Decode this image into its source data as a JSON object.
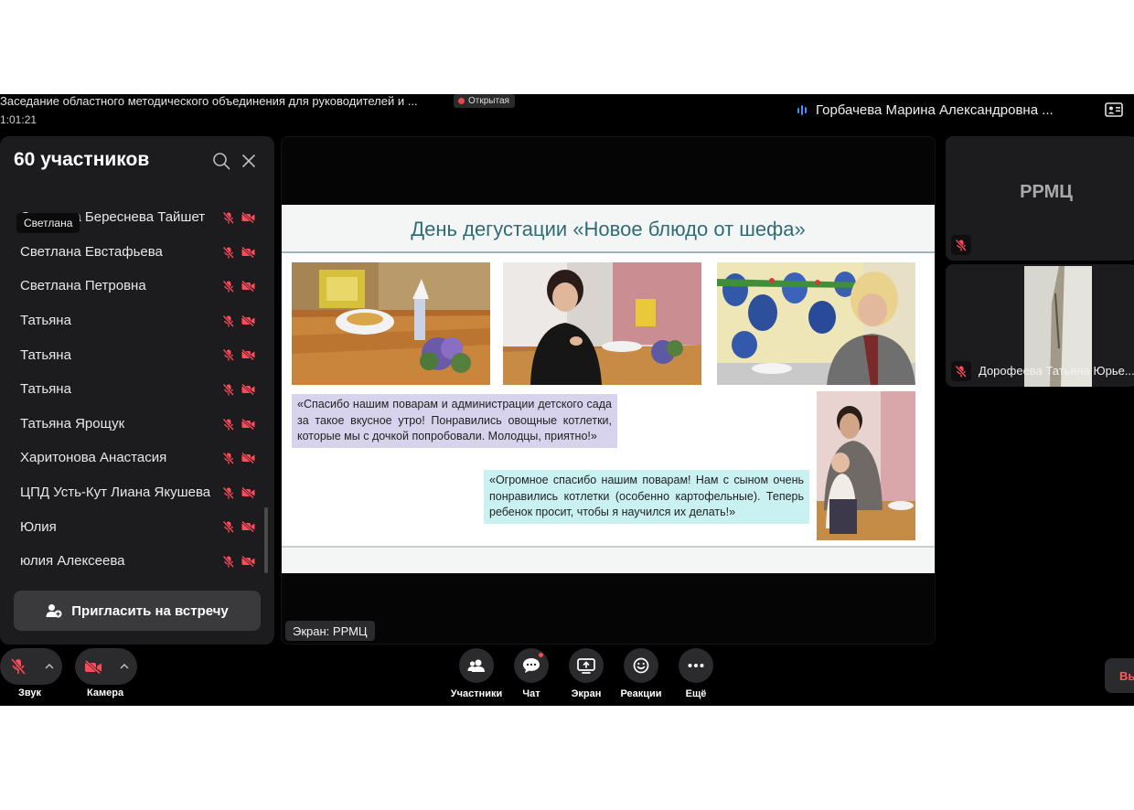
{
  "header": {
    "meeting_title": "Заседание областного методического объединения для руководителей и ...",
    "status_badge": "Открытая",
    "timer": "1:01:21",
    "active_speaker": "Горбачева Марина Александровна ..."
  },
  "participants_panel": {
    "title": "60 участников",
    "tooltip": "Светлана",
    "items": [
      {
        "name": "Светлана Береснева Тайшет"
      },
      {
        "name": "Светлана Евстафьева"
      },
      {
        "name": "Светлана Петровна"
      },
      {
        "name": "Татьяна"
      },
      {
        "name": "Татьяна"
      },
      {
        "name": "Татьяна"
      },
      {
        "name": "Татьяна Ярощук"
      },
      {
        "name": "Харитонова Анастасия"
      },
      {
        "name": "ЦПД Усть-Кут Лиана Якушева"
      },
      {
        "name": "Юлия"
      },
      {
        "name": "юлия Алексеева"
      }
    ],
    "invite_label": "Пригласить на встречу"
  },
  "slide": {
    "title": "День дегустации «Новое блюдо от шефа»",
    "quote1": "«Спасибо нашим поварам и администрации детского сада за такое вкусное утро! Понравились овощные котлетки, которые мы с дочкой попробовали. Молодцы, приятно!»",
    "quote2": "«Огромное спасибо нашим поварам! Нам с сыном очень понравились котлетки (особенно картофельные). Теперь ребенок просит, чтобы я научился их делать!»"
  },
  "screen_label": "Экран: РРМЦ",
  "tiles": [
    {
      "name": "РРМЦ"
    },
    {
      "name": "Дорофеева Татьяна Юрье..."
    }
  ],
  "controls": {
    "sound": "Звук",
    "camera": "Камера",
    "participants": "Участники",
    "chat": "Чат",
    "screen": "Экран",
    "reactions": "Реакции",
    "more": "Ещё",
    "leave": "Вы"
  },
  "colors": {
    "accent_red": "#ff4a5a",
    "speaker_blue": "#4a8cff",
    "slide_title": "#2f6c73",
    "quote1_bg": "#d8d3ec",
    "quote2_bg": "#c9f1f2"
  },
  "icons": [
    "mic-off-icon",
    "camera-off-icon",
    "search-icon",
    "close-icon",
    "add-user-icon",
    "participants-icon",
    "chat-icon",
    "share-screen-icon",
    "reactions-icon",
    "more-icon",
    "layout-icon",
    "chevron-up-icon"
  ]
}
